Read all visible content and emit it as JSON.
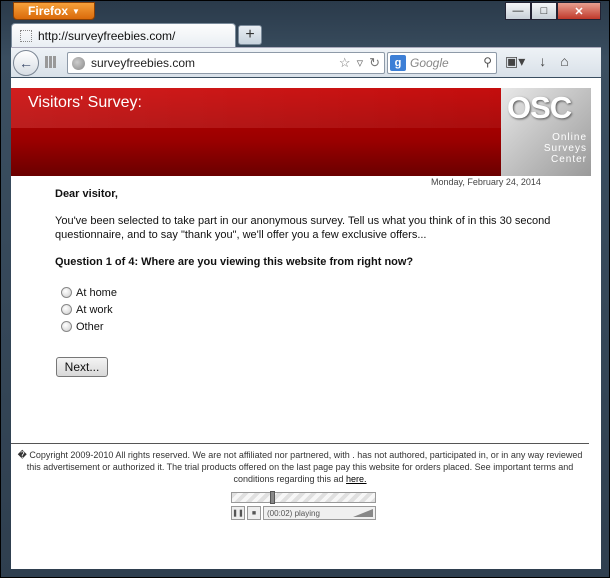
{
  "browser": {
    "app_button": "Firefox",
    "tab_title": "http://surveyfreebies.com/",
    "url": "surveyfreebies.com",
    "search_placeholder": "Google",
    "window_controls": {
      "minimize": "—",
      "maximize": "□",
      "close": "✕"
    }
  },
  "page": {
    "banner_title": "Visitors' Survey:",
    "logo_text": "OSC",
    "logo_subtitle": [
      "Online",
      "Surveys",
      "Center"
    ],
    "date": "Monday, February 24, 2014",
    "greeting": "Dear visitor,",
    "intro": "You've been selected to take part in our anonymous survey. Tell us what you think of in this 30 second questionnaire, and to say \"thank you\", we'll offer you a few exclusive offers...",
    "question": "Question 1 of 4: Where are you viewing this website from right now?",
    "options": [
      "At home",
      "At work",
      "Other"
    ],
    "next_button": "Next..."
  },
  "footer": {
    "text": "� Copyright 2009-2010 All rights reserved. We are not affiliated nor partnered, with . has not authored, participated in, or in any way reviewed this advertisement or authorized it. The trial products offered on the last page pay this website for orders placed. See important terms and conditions regarding this ad",
    "link": "here."
  },
  "player": {
    "status": "(00:02) playing",
    "progress_fraction": 0.27
  }
}
